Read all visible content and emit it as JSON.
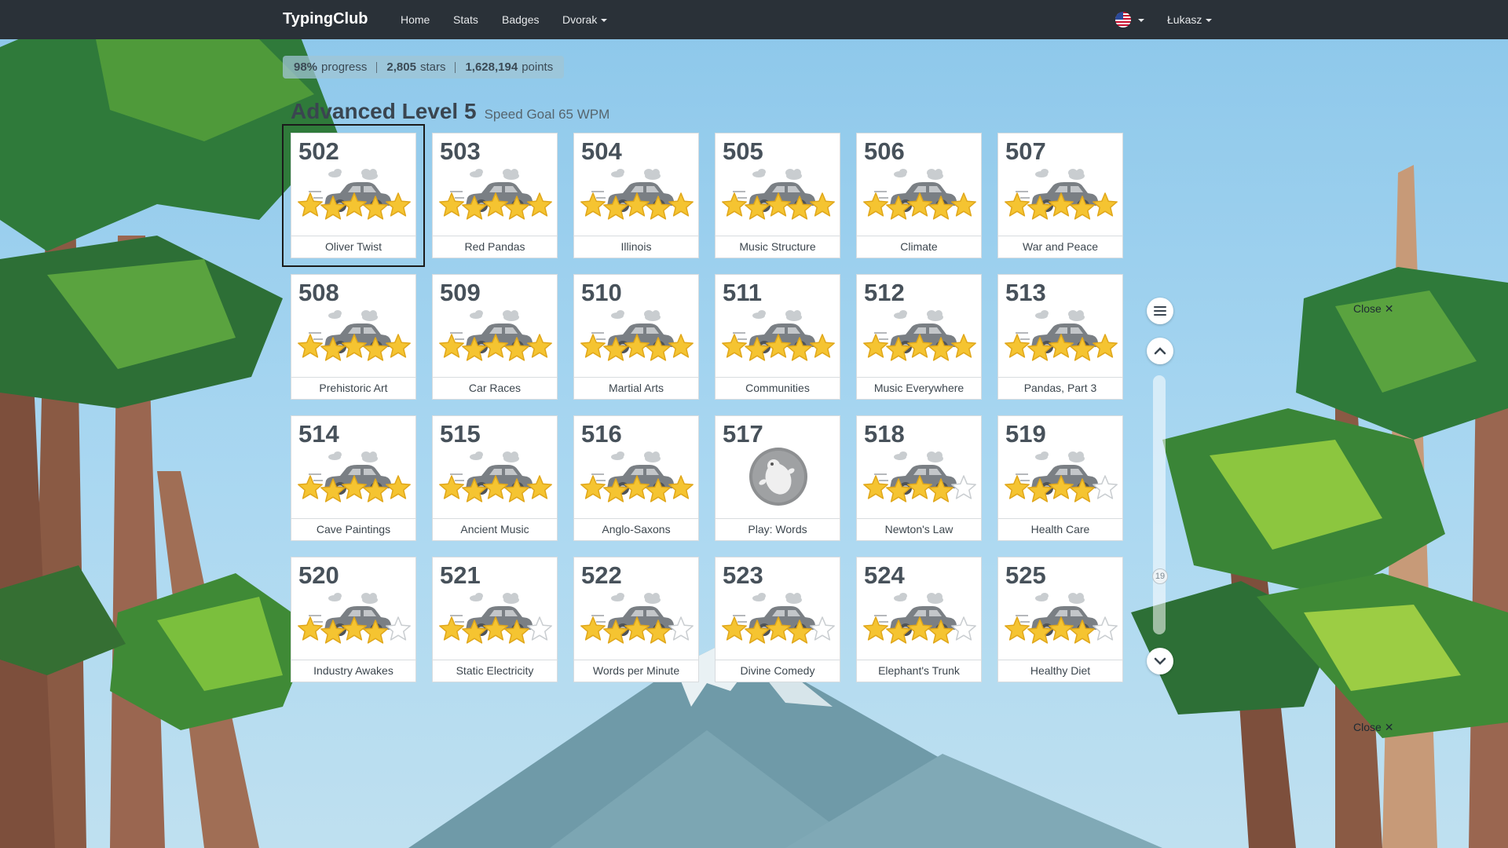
{
  "nav": {
    "brand": "TypingClub",
    "home": "Home",
    "stats": "Stats",
    "badges": "Badges",
    "layout": "Dvorak",
    "user": "Łukasz"
  },
  "stats": {
    "progress_value": "98%",
    "progress_label": "progress",
    "stars_value": "2,805",
    "stars_label": "stars",
    "points_value": "1,628,194",
    "points_label": "points"
  },
  "level": {
    "title": "Advanced Level 5",
    "speed_goal": "Speed Goal 65 WPM"
  },
  "lessons": [
    {
      "num": "502",
      "name": "Oliver Twist",
      "stars": 5,
      "type": "car",
      "selected": true
    },
    {
      "num": "503",
      "name": "Red Pandas",
      "stars": 5,
      "type": "car"
    },
    {
      "num": "504",
      "name": "Illinois",
      "stars": 5,
      "type": "car"
    },
    {
      "num": "505",
      "name": "Music Structure",
      "stars": 5,
      "type": "car"
    },
    {
      "num": "506",
      "name": "Climate",
      "stars": 5,
      "type": "car"
    },
    {
      "num": "507",
      "name": "War and Peace",
      "stars": 5,
      "type": "car"
    },
    {
      "num": "508",
      "name": "Prehistoric Art",
      "stars": 5,
      "type": "car"
    },
    {
      "num": "509",
      "name": "Car Races",
      "stars": 5,
      "type": "car"
    },
    {
      "num": "510",
      "name": "Martial Arts",
      "stars": 5,
      "type": "car"
    },
    {
      "num": "511",
      "name": "Communities",
      "stars": 5,
      "type": "car"
    },
    {
      "num": "512",
      "name": "Music Everywhere",
      "stars": 5,
      "type": "car"
    },
    {
      "num": "513",
      "name": "Pandas, Part 3",
      "stars": 5,
      "type": "car"
    },
    {
      "num": "514",
      "name": "Cave Paintings",
      "stars": 5,
      "type": "car"
    },
    {
      "num": "515",
      "name": "Ancient Music",
      "stars": 5,
      "type": "car"
    },
    {
      "num": "516",
      "name": "Anglo-Saxons",
      "stars": 5,
      "type": "car"
    },
    {
      "num": "517",
      "name": "Play: Words",
      "stars": 0,
      "type": "game"
    },
    {
      "num": "518",
      "name": "Newton's Law",
      "stars": 4,
      "type": "car"
    },
    {
      "num": "519",
      "name": "Health Care",
      "stars": 4,
      "type": "car"
    },
    {
      "num": "520",
      "name": "Industry Awakes",
      "stars": 4,
      "type": "car"
    },
    {
      "num": "521",
      "name": "Static Electricity",
      "stars": 4,
      "type": "car"
    },
    {
      "num": "522",
      "name": "Words per Minute",
      "stars": 4,
      "type": "car"
    },
    {
      "num": "523",
      "name": "Divine Comedy",
      "stars": 4,
      "type": "car"
    },
    {
      "num": "524",
      "name": "Elephant's Trunk",
      "stars": 4,
      "type": "car"
    },
    {
      "num": "525",
      "name": "Healthy Diet",
      "stars": 4,
      "type": "car"
    }
  ],
  "scroller": {
    "position_label": "19"
  },
  "close_label": "Close",
  "icons": {
    "menu": "menu-icon",
    "up": "chevron-up-icon",
    "down": "chevron-down-icon",
    "flag": "us-flag-icon"
  },
  "colors": {
    "navbar": "#2a3138",
    "star_fill": "#f5c431",
    "star_outline": "#e0a71b",
    "car": "#7a7f84"
  }
}
